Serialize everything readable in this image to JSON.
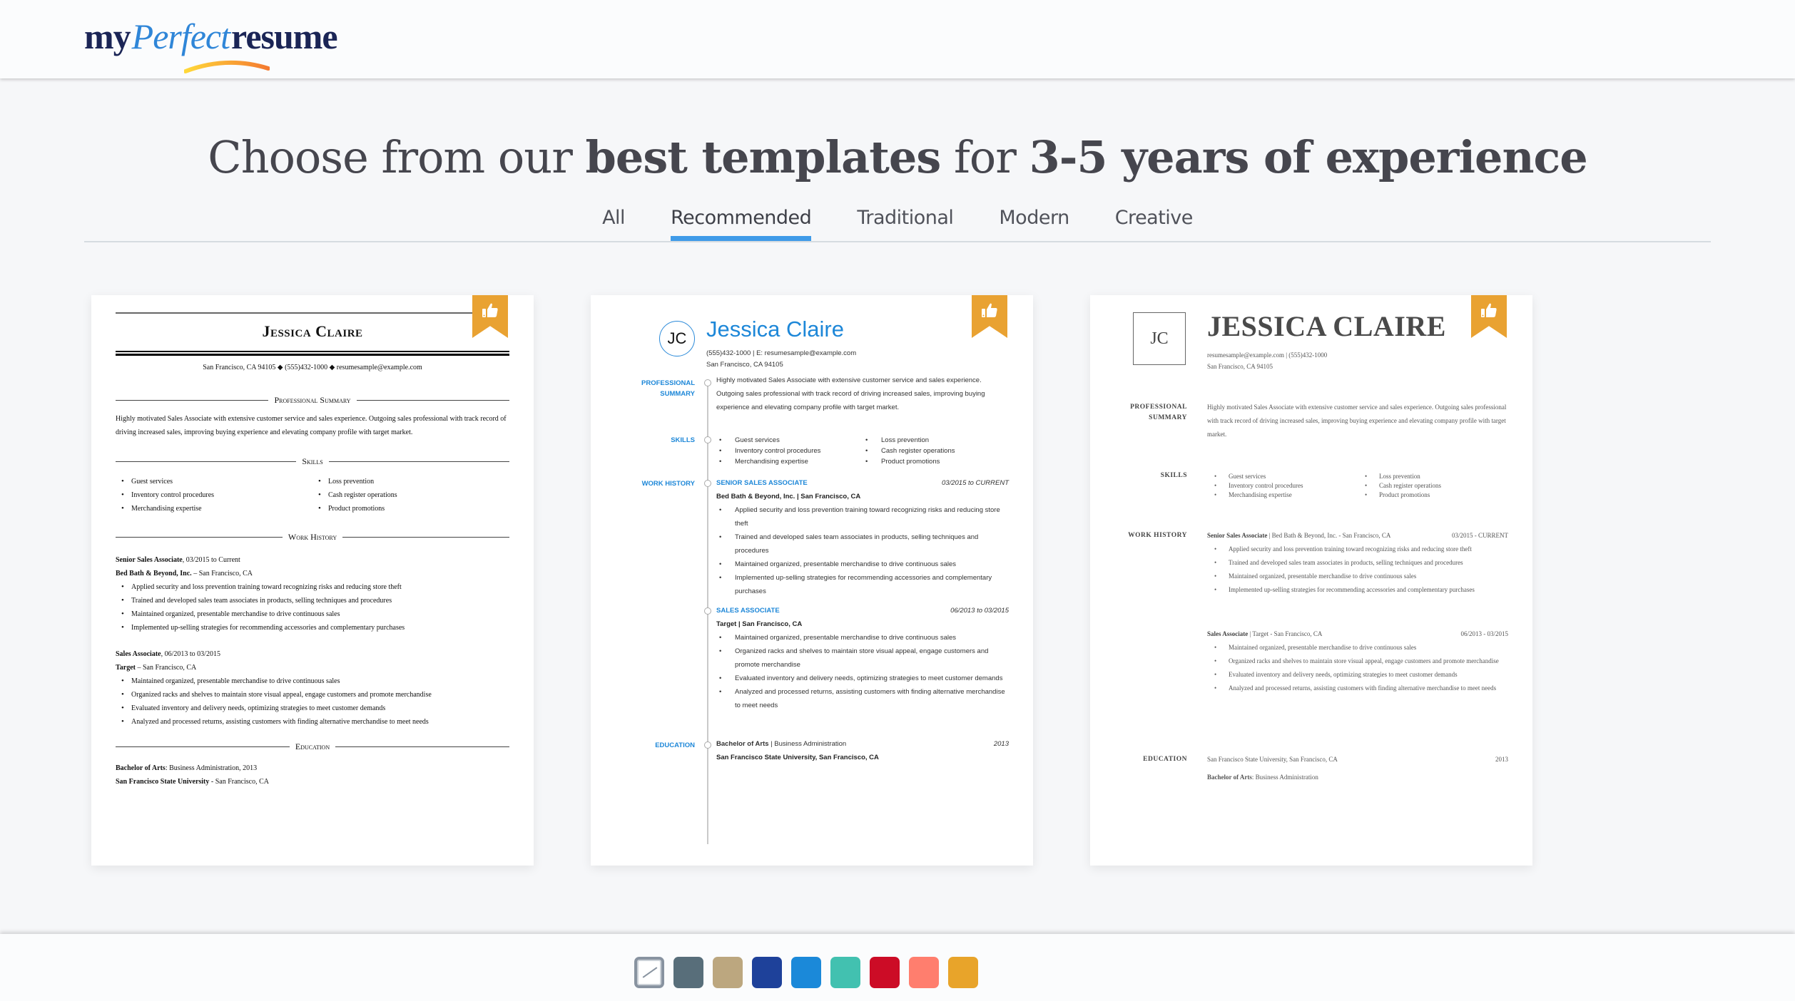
{
  "header": {
    "logo": {
      "part1": "my",
      "part2": "Perfect",
      "part3": "resume"
    }
  },
  "headline": {
    "t1": "Choose from our ",
    "t2": "best templates",
    "t3": " for ",
    "t4": "3-5 years of experience"
  },
  "tabs": [
    {
      "label": "All",
      "active": false
    },
    {
      "label": "Recommended",
      "active": true
    },
    {
      "label": "Traditional",
      "active": false
    },
    {
      "label": "Modern",
      "active": false
    },
    {
      "label": "Creative",
      "active": false
    }
  ],
  "resume": {
    "name": "Jessica Claire",
    "name_upper": "JESSICA CLAIRE",
    "initials": "JC",
    "address": "San Francisco, CA 94105",
    "phone": "(555)432-1000",
    "email": "resumesample@example.com",
    "contact_line": "San Francisco, CA 94105 ◆ (555)432-1000 ◆ resumesample@example.com",
    "contact_line2": "(555)432-1000 | E: resumesample@example.com",
    "contact_line3": "resumesample@example.com  |  (555)432-1000",
    "sections": {
      "summary": "Professional Summary",
      "summary_upper1": "PROFESSIONAL",
      "summary_upper2": "SUMMARY",
      "skills": "Skills",
      "skills_upper": "SKILLS",
      "work": "Work History",
      "work_upper": "WORK HISTORY",
      "education": "Education",
      "education_upper": "EDUCATION"
    },
    "summary": "Highly motivated Sales Associate with extensive customer service and sales experience. Outgoing sales professional with track record of driving increased sales, improving buying experience and elevating company profile with target market.",
    "skills_left": [
      "Guest services",
      "Inventory control procedures",
      "Merchandising expertise"
    ],
    "skills_right": [
      "Loss prevention",
      "Cash register operations",
      "Product promotions"
    ],
    "jobs": [
      {
        "title": "Senior Sales Associate",
        "title_upper": "SENIOR SALES ASSOCIATE",
        "dates_c1": ", 03/2015 to Current",
        "dates_c2": "03/2015 to CURRENT",
        "dates_c3": "03/2015 - CURRENT",
        "company": "Bed Bath & Beyond, Inc.",
        "company_loc_c1": " – San Francisco, CA",
        "company_line_c2": "Bed Bath & Beyond, Inc. | San Francisco, CA",
        "company_line_c3": "  |  Bed Bath & Beyond, Inc. - San Francisco, CA",
        "bullets": [
          "Applied security and loss prevention training toward recognizing risks and reducing store theft",
          "Trained and developed sales team associates in products, selling techniques and procedures",
          "Maintained organized, presentable merchandise to drive continuous sales",
          "Implemented up-selling strategies for recommending accessories and complementary purchases"
        ]
      },
      {
        "title": "Sales Associate",
        "title_upper": "SALES ASSOCIATE",
        "dates_c1": ", 06/2013 to 03/2015",
        "dates_c2": "06/2013 to 03/2015",
        "dates_c3": "06/2013 - 03/2015",
        "company": "Target",
        "company_loc_c1": " – San Francisco, CA",
        "company_line_c2": "Target | San Francisco, CA",
        "company_line_c3": "  |  Target - San Francisco, CA",
        "bullets": [
          "Maintained organized, presentable merchandise to drive continuous sales",
          "Organized racks and shelves to maintain store visual appeal, engage customers and promote merchandise",
          "Evaluated inventory and delivery needs, optimizing strategies to meet customer demands",
          "Analyzed and processed returns, assisting customers with finding alternative merchandise to meet needs"
        ]
      }
    ],
    "education": {
      "degree": "Bachelor of Arts",
      "field_c1": ": Business Administration, 2013",
      "field_c2": " | Business Administration",
      "field_c3": ": Business Administration",
      "year": "2013",
      "school": "San Francisco State University",
      "school_loc_c1": " - San Francisco, CA",
      "school_line_c2": "San Francisco State University, San Francisco, CA",
      "school_line_c3": "San Francisco State University, San Francisco, CA"
    }
  },
  "cards": [
    {
      "style": "Traditional",
      "badge": "recommended"
    },
    {
      "style": "Modern",
      "badge": "recommended"
    },
    {
      "style": "Executive",
      "badge": "recommended"
    }
  ],
  "color_swatches": [
    {
      "name": "none",
      "color": "#ffffff",
      "selected": true
    },
    {
      "name": "slate",
      "color": "#586e7a"
    },
    {
      "name": "tan",
      "color": "#bca77f"
    },
    {
      "name": "navy",
      "color": "#1e419a"
    },
    {
      "name": "blue",
      "color": "#1b89d9"
    },
    {
      "name": "teal",
      "color": "#42c1b0"
    },
    {
      "name": "red",
      "color": "#cc0c26"
    },
    {
      "name": "salmon",
      "color": "#ff7e6e"
    },
    {
      "name": "orange",
      "color": "#e8a42a"
    }
  ],
  "colors": {
    "accent_tab": "#3f9be8",
    "ribbon": "#e9a232",
    "brand_blue": "#1d87d8"
  }
}
